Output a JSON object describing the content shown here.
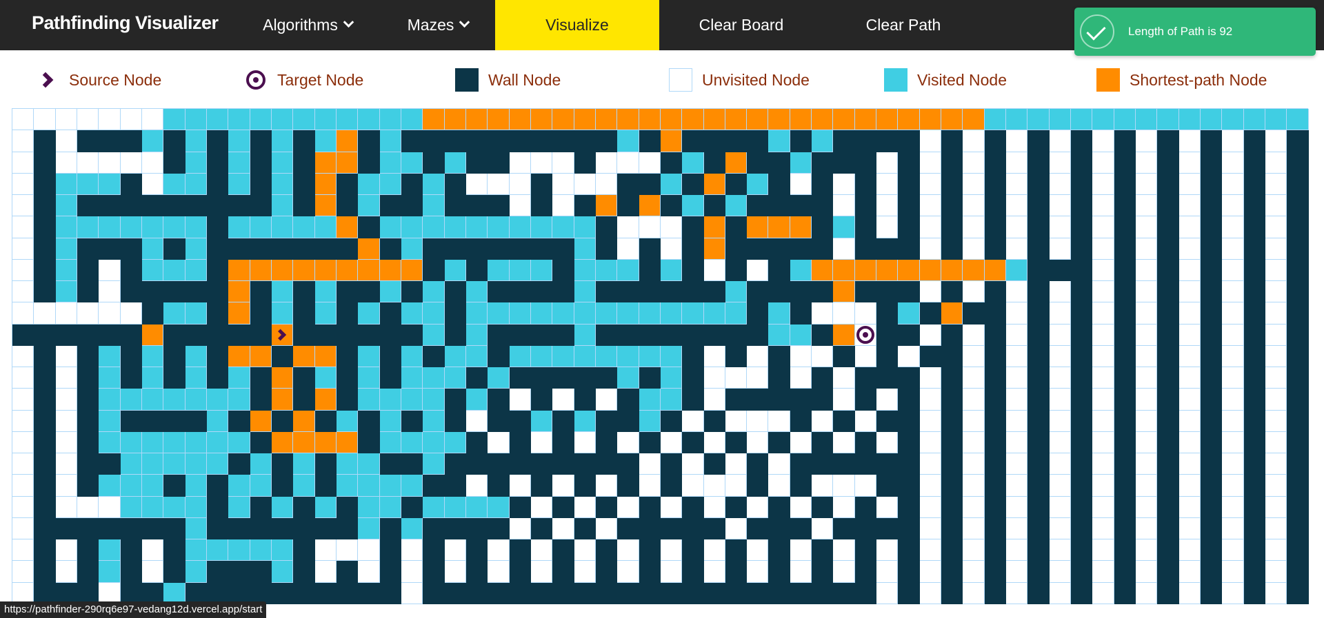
{
  "navbar": {
    "brand": "Pathfinding Visualizer",
    "algorithms_label": "Algorithms",
    "mazes_label": "Mazes",
    "visualize_label": "Visualize",
    "clear_board_label": "Clear Board",
    "clear_path_label": "Clear Path"
  },
  "toast": {
    "message": "Length of Path is 92"
  },
  "legend": {
    "source": "Source Node",
    "target": "Target Node",
    "wall": "Wall Node",
    "unvisited": "Unvisited Node",
    "visited": "Visited Node",
    "shortest": "Shortest-path Node"
  },
  "colors": {
    "navbar_bg": "#262626",
    "visualize_bg": "#ffe600",
    "wall": "#0c3547",
    "visited": "#40cee3",
    "shortest_path": "#ff8c00",
    "unvisited_border": "#afd8f8",
    "toast_bg": "#2fb779",
    "legend_text": "#8b2e0b",
    "node_icon": "#4b0f4f"
  },
  "icons": {
    "algorithms_dropdown": "chevron-down-icon",
    "mazes_dropdown": "chevron-down-icon",
    "toast": "check-circle-icon",
    "source": "chevron-right-icon",
    "target": "target-icon"
  },
  "grid": {
    "rows": 23,
    "cols": 60,
    "legend_codes": {
      ".": "unvisited",
      "#": "wall",
      "v": "visited",
      "o": "shortest-path",
      "S": "source",
      "T": "target"
    },
    "cells": [
      ".......vvvvvvvvvvvvoooooooooooooooooooooooooovvvvvvvvvvvvvvv...",
      ".#.###v#v#v#v#vo#v##########v#o####v#v###",
      ".#.....#v#v#v#oo#vv#v##...#...#v#o##v###",
      ".#vvv#.vv#v#v#o#vv#v#...#...##v#o#v#",
      ".#v#########v#o#v##v###.#.#o#o#v#v###",
      ".#vvvvvvv#vvvvvo#vvvvvvvvvv#...#o#ooo#v#",
      ".#v###v#v#######o#v#######v#.#.#o#####.###",
      ".#v#.#vvv#ooooooooo#v#vvv#vvv#v#.#.#vooooooooov##",
      ".#v#.#####o#v#v##v#v#v####v######v####o###",
      "......#vv#o#v#v#v#vv#vvvvvvvvvvvvv#v#...#v#o#",
      "######o#####S######v#v####v########vv#oT##",
      ".#.#v#v#v#oo#oo#v#v#vv#vvvvvvvv#.#.#..#.#.#",
      ".#.#v#v#v#v#o#v#v#vvv#v#####v#v#...#.#.###",
      ".#.#vvvvvvv#o#o#vvvv#v#.#.#.#vv#.#####.#.#",
      ".#.#v####v#o#o#v#v#v#.##v#v##v#.#...#.#.#",
      ".#.#vvvvvvv#oooo#vvvv#.#.#.#.#.#.#.#.#.#.#",
      ".#.##vvvvv#v#v#vv##v#########.#.#.#.#####",
      ".#.#vvv#v#vv#v#vvvv##.#.#.#.#.#...#.#...#",
      ".#...vvvv#v#v#v#vv#vvvv#.#.#.#.#.#.#.#.#.#",
      ".#######v#######v#v####.#.#.#####.###.###",
      ".#.#v#.#vvvvv#...#.#.#.#.#.#.#.#.#.#.#.#.#",
      ".#.#v#.#v###v#.#.#.#.#.#.#.#.#.#.#.#.#.#.#",
      ".###.##v##########.####################"
    ]
  },
  "status_bar": {
    "url": "https://pathfinder-290rq6e97-vedang12d.vercel.app/start"
  }
}
